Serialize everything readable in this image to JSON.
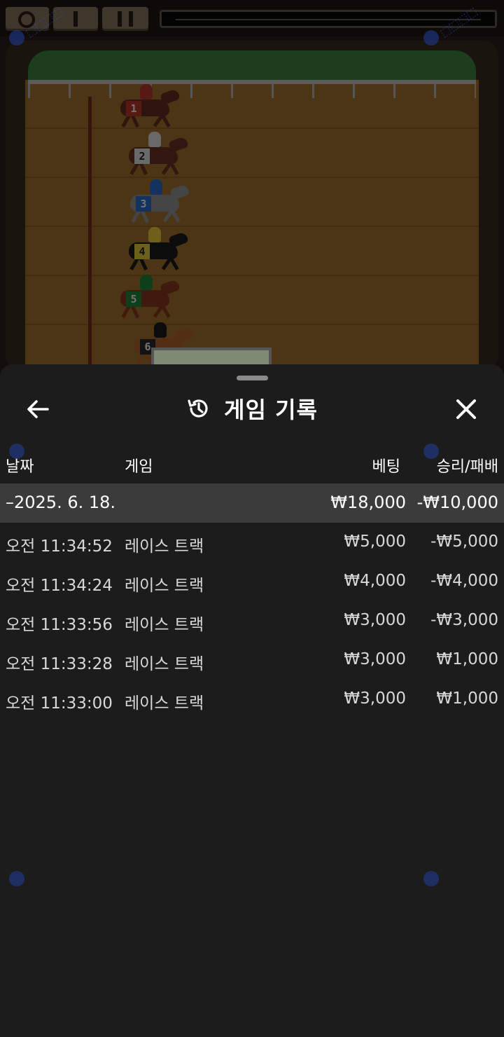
{
  "game": {
    "horses": [
      "1",
      "2",
      "3",
      "4",
      "5",
      "6"
    ]
  },
  "sheet": {
    "title": "게임 기록",
    "icons": {
      "back": "arrow-left-icon",
      "title": "history-icon",
      "close": "close-icon"
    },
    "columns": {
      "date": "날짜",
      "game": "게임",
      "bet": "베팅",
      "winloss": "승리/패배"
    },
    "group": {
      "date": "–2025. 6. 18.",
      "bet": "₩18,000",
      "winloss": "-₩10,000"
    },
    "rows": [
      {
        "time": "오전 11:34:52",
        "game": "레이스 트랙",
        "bet": "₩5,000",
        "winloss": "-₩5,000"
      },
      {
        "time": "오전 11:34:24",
        "game": "레이스 트랙",
        "bet": "₩4,000",
        "winloss": "-₩4,000"
      },
      {
        "time": "오전 11:33:56",
        "game": "레이스 트랙",
        "bet": "₩3,000",
        "winloss": "-₩3,000"
      },
      {
        "time": "오전 11:33:28",
        "game": "레이스 트랙",
        "bet": "₩3,000",
        "winloss": "₩1,000"
      },
      {
        "time": "오전 11:33:00",
        "game": "레이스 트랙",
        "bet": "₩3,000",
        "winloss": "₩1,000"
      }
    ]
  },
  "colors": {
    "sheet_bg": "#1c1c1c",
    "group_bg": "#3b3b3b",
    "text": "#ffffff"
  }
}
